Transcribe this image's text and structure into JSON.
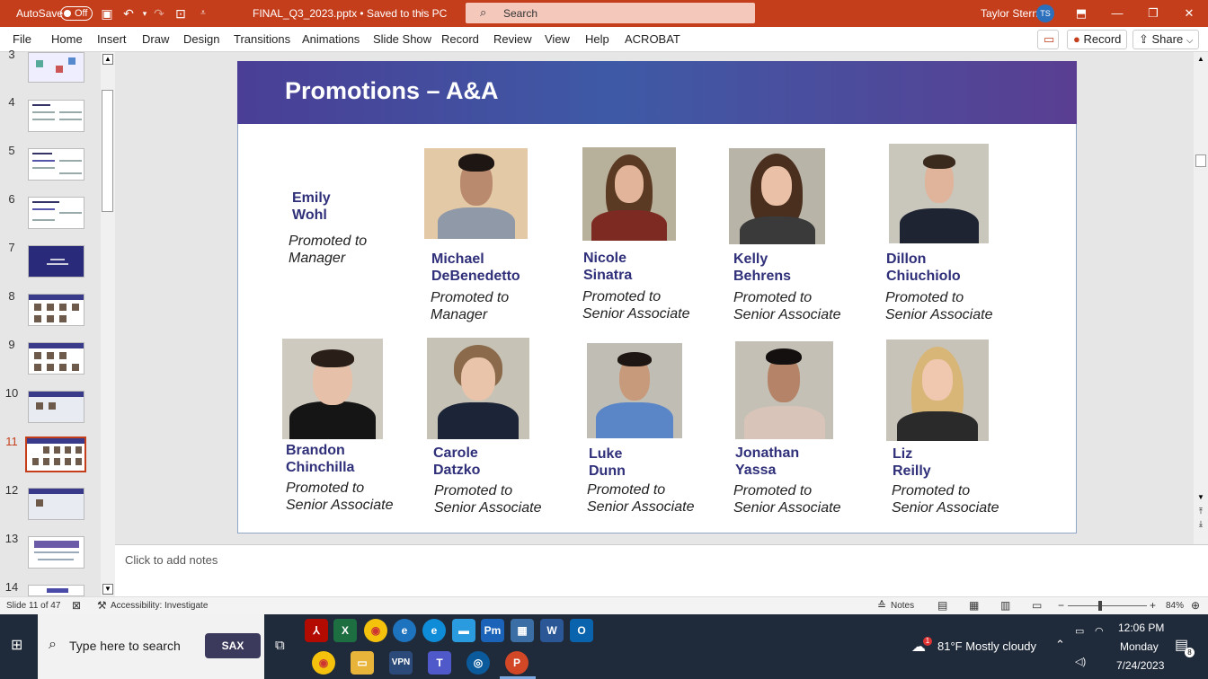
{
  "titlebar": {
    "autosave_label": "AutoSave",
    "autosave_state": "Off",
    "file_title": "FINAL_Q3_2023.pptx • Saved to this PC",
    "search_placeholder": "Search",
    "user_name": "Taylor Stern",
    "user_initials": "TS"
  },
  "ribbon": {
    "tabs": [
      "File",
      "Home",
      "Insert",
      "Draw",
      "Design",
      "Transitions",
      "Animations",
      "Slide Show",
      "Record",
      "Review",
      "View",
      "Help",
      "ACROBAT"
    ],
    "record_button": "Record",
    "share_button": "Share"
  },
  "thumbnails": {
    "numbers": [
      "3",
      "4",
      "5",
      "6",
      "7",
      "8",
      "9",
      "10",
      "11",
      "12",
      "13",
      "14"
    ],
    "selected": "11"
  },
  "slide": {
    "title": "Promotions – A&A",
    "people": [
      {
        "first": "Emily",
        "last": "Wohl",
        "promo1": "Promoted to",
        "promo2": "Manager"
      },
      {
        "first": "Michael",
        "last": "DeBenedetto",
        "promo1": "Promoted to",
        "promo2": "Manager"
      },
      {
        "first": "Nicole",
        "last": "Sinatra",
        "promo1": "Promoted to",
        "promo2": "Senior Associate"
      },
      {
        "first": "Kelly",
        "last": "Behrens",
        "promo1": "Promoted to",
        "promo2": "Senior Associate"
      },
      {
        "first": "Dillon",
        "last": "Chiuchiolo",
        "promo1": "Promoted to",
        "promo2": "Senior Associate"
      },
      {
        "first": "Brandon",
        "last": "Chinchilla",
        "promo1": "Promoted to",
        "promo2": "Senior Associate"
      },
      {
        "first": "Carole",
        "last": "Datzko",
        "promo1": "Promoted to",
        "promo2": "Senior Associate"
      },
      {
        "first": "Luke",
        "last": "Dunn",
        "promo1": "Promoted to",
        "promo2": "Senior Associate"
      },
      {
        "first": "Jonathan",
        "last": "Yassa",
        "promo1": "Promoted to",
        "promo2": "Senior Associate"
      },
      {
        "first": "Liz",
        "last": "Reilly",
        "promo1": "Promoted to",
        "promo2": "Senior Associate"
      }
    ]
  },
  "notes": {
    "placeholder": "Click to add notes"
  },
  "statusbar": {
    "slide_info": "Slide 11 of 47",
    "accessibility": "Accessibility: Investigate",
    "notes_button": "Notes",
    "zoom": "84%"
  },
  "taskbar": {
    "search_placeholder": "Type here to search",
    "sax_label": "SAX",
    "weather": "81°F  Mostly cloudy",
    "time": "12:06 PM",
    "day": "Monday",
    "date": "7/24/2023",
    "notif_count": "8",
    "weather_badge": "1"
  }
}
